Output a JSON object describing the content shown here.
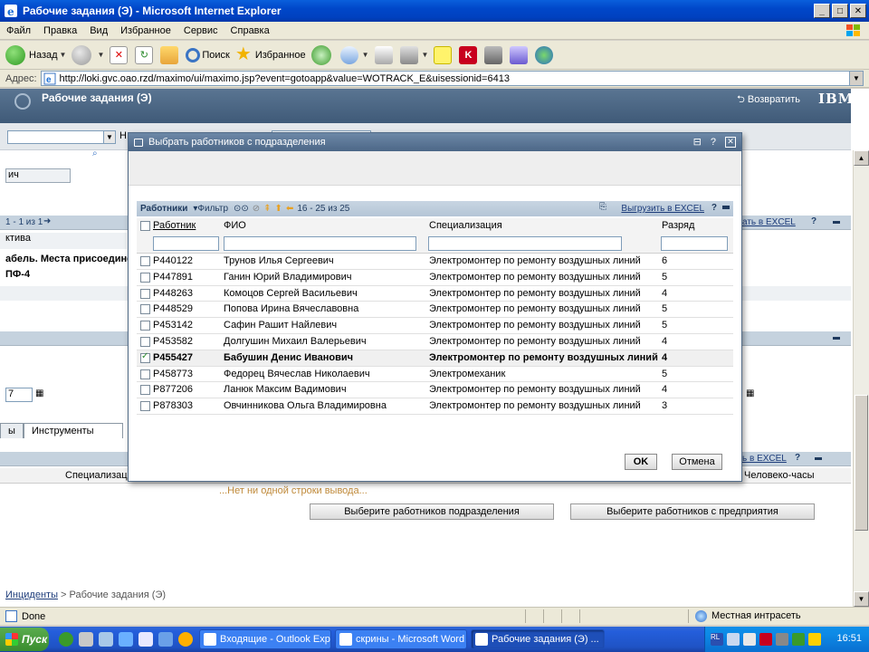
{
  "window": {
    "title": "Рабочие задания (Э) - Microsoft Internet Explorer",
    "menu": [
      "Файл",
      "Правка",
      "Вид",
      "Избранное",
      "Сервис",
      "Справка"
    ],
    "toolbar": {
      "back": "Назад",
      "search": "Поиск",
      "favorites": "Избранное"
    },
    "address_label": "Адрес:",
    "address": "http://loki.gvc.oao.rzd/maximo/ui/maximo.jsp?event=gotoapp&value=WOTRACK_E&uisessionid=6413"
  },
  "app": {
    "name": "Рабочие задания (Э)",
    "return_link": "Возвратить",
    "brand": "IBM.",
    "hotkey_label": "Н"
  },
  "background": {
    "field_value": "ич",
    "sec1_paging": "1 - 1 из 1",
    "sec1_excel": "ать в EXCEL",
    "col_label": "ктива",
    "bold_line1": "абель. Места присоедине",
    "bold_line2": "ПФ-4",
    "date_value": "7",
    "tab_left": "ы",
    "tab_tools": "Инструменты",
    "col_spec": "Специализаци",
    "col_manhours": "Человеко-часы",
    "excel2": "ь в EXCEL",
    "empty_msg": "...Нет ни одной строки вывода...",
    "btn_select_dept": "Выберите работников подразделения",
    "btn_select_ent": "Выберите работников с предприятия"
  },
  "breadcrumb": {
    "link": "Инциденты",
    "sep": " > ",
    "current": "Рабочие задания (Э)"
  },
  "dialog": {
    "title": "Выбрать работников с подразделения",
    "table_name": "Работники",
    "filter": "Фильтр",
    "paging": "16 - 25 из 25",
    "excel": "Выгрузить в EXCEL",
    "columns": {
      "worker": "Работник",
      "fio": "ФИО",
      "spec": "Специализация",
      "grade": "Разряд"
    },
    "rows": [
      {
        "id": "P440122",
        "fio": "Трунов Илья Сергеевич",
        "spec": "Электромонтер по ремонту воздушных линий",
        "grade": "6",
        "checked": false
      },
      {
        "id": "P447891",
        "fio": "Ганин Юрий Владимирович",
        "spec": "Электромонтер по ремонту воздушных линий",
        "grade": "5",
        "checked": false
      },
      {
        "id": "P448263",
        "fio": "Комоцов Сергей Васильевич",
        "spec": "Электромонтер по ремонту воздушных линий",
        "grade": "4",
        "checked": false
      },
      {
        "id": "P448529",
        "fio": "Попова Ирина Вячеславовна",
        "spec": "Электромонтер по ремонту воздушных линий",
        "grade": "5",
        "checked": false
      },
      {
        "id": "P453142",
        "fio": "Сафин Рашит Найлевич",
        "spec": "Электромонтер по ремонту воздушных линий",
        "grade": "5",
        "checked": false
      },
      {
        "id": "P453582",
        "fio": "Долгушин Михаил Валерьевич",
        "spec": "Электромонтер по ремонту воздушных линий",
        "grade": "4",
        "checked": false
      },
      {
        "id": "P455427",
        "fio": "Бабушин Денис Иванович",
        "spec": "Электромонтер по ремонту воздушных линий",
        "grade": "4",
        "checked": true
      },
      {
        "id": "P458773",
        "fio": "Федорец Вячеслав Николаевич",
        "spec": "Электромеханик",
        "grade": "5",
        "checked": false
      },
      {
        "id": "P877206",
        "fio": "Ланюк Максим Вадимович",
        "spec": "Электромонтер по ремонту воздушных линий",
        "grade": "4",
        "checked": false
      },
      {
        "id": "P878303",
        "fio": "Овчинникова Ольга Владимировна",
        "spec": "Электромонтер по ремонту воздушных линий",
        "grade": "3",
        "checked": false
      }
    ],
    "ok": "OK",
    "cancel": "Отмена"
  },
  "status": {
    "done": "Done",
    "zone": "Местная интрасеть"
  },
  "taskbar": {
    "start": "Пуск",
    "tasks": [
      "Входящие - Outlook Exp...",
      "скрины - Microsoft Word",
      "Рабочие задания (Э) ..."
    ],
    "clock": "16:51"
  },
  "colors": {
    "accent": "#0041bf",
    "maximo_header": "#4c6787",
    "section": "#c5d2de"
  }
}
